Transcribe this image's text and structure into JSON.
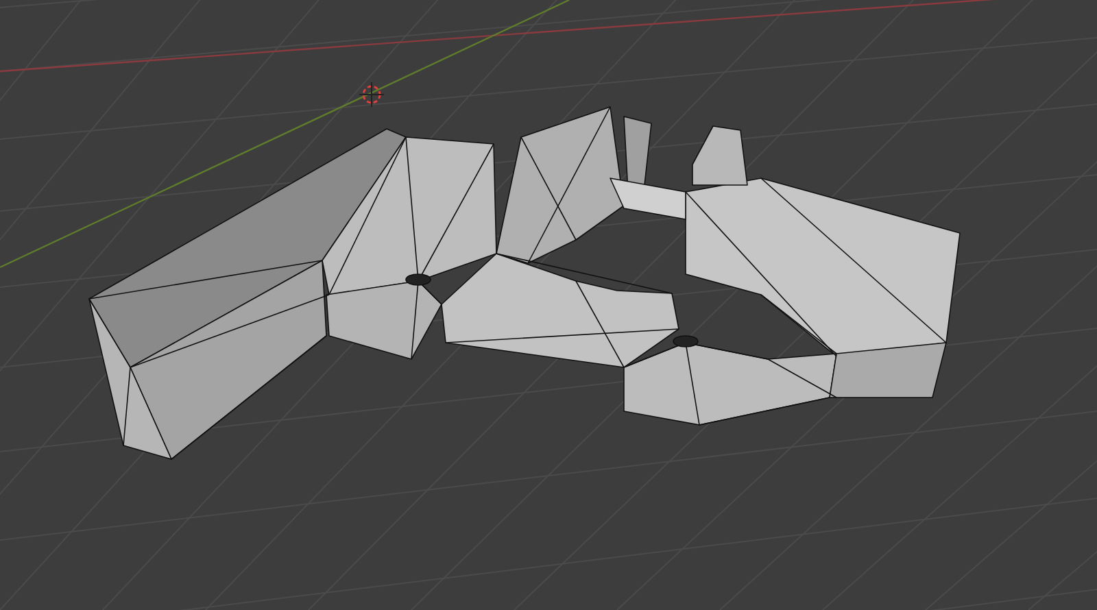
{
  "viewport": {
    "kind": "perspective",
    "grid": true,
    "axes": true,
    "cursor": true
  }
}
